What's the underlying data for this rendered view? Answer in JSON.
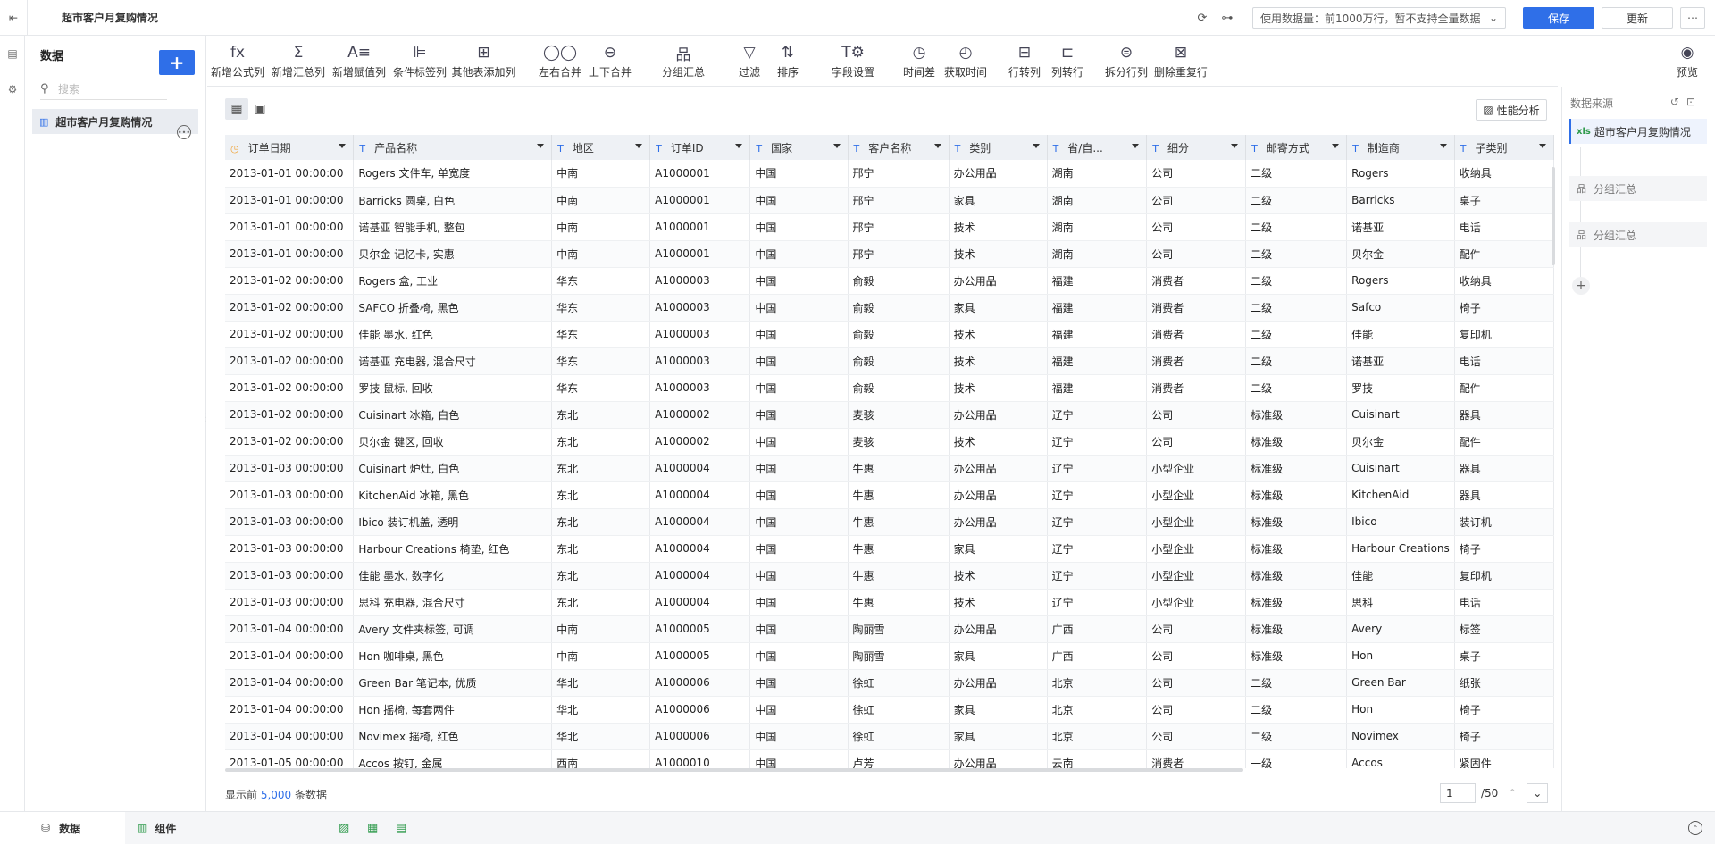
{
  "topbar": {
    "title": "超市客户月复购情况",
    "data_select": "使用数据量：前1000万行，暂不支持全量数据",
    "save": "保存",
    "refresh": "更新"
  },
  "sidebar": {
    "title": "数据",
    "search_placeholder": "搜索",
    "items": [
      {
        "label": "超市客户月复购情况"
      }
    ]
  },
  "toolbar": {
    "tools": [
      {
        "icon": "fx",
        "label": "新增公式列"
      },
      {
        "icon": "Σ",
        "label": "新增汇总列"
      },
      {
        "icon": "A≡",
        "label": "新增赋值列"
      },
      {
        "icon": "⊫",
        "label": "条件标签列"
      },
      {
        "icon": "⊞",
        "label": "其他表添加列"
      },
      {
        "icon": "◯◯",
        "label": "左右合并"
      },
      {
        "icon": "⊖",
        "label": "上下合并"
      },
      {
        "icon": "品",
        "label": "分组汇总"
      },
      {
        "icon": "▽",
        "label": "过滤"
      },
      {
        "icon": "⇅",
        "label": "排序"
      },
      {
        "icon": "T⚙",
        "label": "字段设置"
      },
      {
        "icon": "◷",
        "label": "时间差"
      },
      {
        "icon": "◴",
        "label": "获取时间"
      },
      {
        "icon": "⊟",
        "label": "行转列"
      },
      {
        "icon": "⊏",
        "label": "列转行"
      },
      {
        "icon": "⊜",
        "label": "拆分行列"
      },
      {
        "icon": "⊠",
        "label": "删除重复行"
      }
    ],
    "preview": "预览"
  },
  "content": {
    "perf_button": "性能分析",
    "footer_prefix": "显示前 ",
    "footer_count": "5,000",
    "footer_suffix": " 条数据",
    "page_current": "1",
    "page_total": "/50"
  },
  "table": {
    "columns": [
      "订单日期",
      "产品名称",
      "地区",
      "订单ID",
      "国家",
      "客户名称",
      "类别",
      "省/自...",
      "细分",
      "邮寄方式",
      "制造商",
      "子类别"
    ],
    "rows": [
      [
        "2013-01-01 00:00:00",
        "Rogers 文件车, 单宽度",
        "中南",
        "A1000001",
        "中国",
        "邢宁",
        "办公用品",
        "湖南",
        "公司",
        "二级",
        "Rogers",
        "收纳具"
      ],
      [
        "2013-01-01 00:00:00",
        "Barricks 圆桌, 白色",
        "中南",
        "A1000001",
        "中国",
        "邢宁",
        "家具",
        "湖南",
        "公司",
        "二级",
        "Barricks",
        "桌子"
      ],
      [
        "2013-01-01 00:00:00",
        "诺基亚 智能手机, 整包",
        "中南",
        "A1000001",
        "中国",
        "邢宁",
        "技术",
        "湖南",
        "公司",
        "二级",
        "诺基亚",
        "电话"
      ],
      [
        "2013-01-01 00:00:00",
        "贝尔金 记忆卡, 实惠",
        "中南",
        "A1000001",
        "中国",
        "邢宁",
        "技术",
        "湖南",
        "公司",
        "二级",
        "贝尔金",
        "配件"
      ],
      [
        "2013-01-02 00:00:00",
        "Rogers 盒, 工业",
        "华东",
        "A1000003",
        "中国",
        "俞毅",
        "办公用品",
        "福建",
        "消费者",
        "二级",
        "Rogers",
        "收纳具"
      ],
      [
        "2013-01-02 00:00:00",
        "SAFCO 折叠椅, 黑色",
        "华东",
        "A1000003",
        "中国",
        "俞毅",
        "家具",
        "福建",
        "消费者",
        "二级",
        "Safco",
        "椅子"
      ],
      [
        "2013-01-02 00:00:00",
        "佳能 墨水, 红色",
        "华东",
        "A1000003",
        "中国",
        "俞毅",
        "技术",
        "福建",
        "消费者",
        "二级",
        "佳能",
        "复印机"
      ],
      [
        "2013-01-02 00:00:00",
        "诺基亚 充电器, 混合尺寸",
        "华东",
        "A1000003",
        "中国",
        "俞毅",
        "技术",
        "福建",
        "消费者",
        "二级",
        "诺基亚",
        "电话"
      ],
      [
        "2013-01-02 00:00:00",
        "罗技 鼠标, 回收",
        "华东",
        "A1000003",
        "中国",
        "俞毅",
        "技术",
        "福建",
        "消费者",
        "二级",
        "罗技",
        "配件"
      ],
      [
        "2013-01-02 00:00:00",
        "Cuisinart 冰箱, 白色",
        "东北",
        "A1000002",
        "中国",
        "麦骇",
        "办公用品",
        "辽宁",
        "公司",
        "标准级",
        "Cuisinart",
        "器具"
      ],
      [
        "2013-01-02 00:00:00",
        "贝尔金 键区, 回收",
        "东北",
        "A1000002",
        "中国",
        "麦骇",
        "技术",
        "辽宁",
        "公司",
        "标准级",
        "贝尔金",
        "配件"
      ],
      [
        "2013-01-03 00:00:00",
        "Cuisinart 炉灶, 白色",
        "东北",
        "A1000004",
        "中国",
        "牛惠",
        "办公用品",
        "辽宁",
        "小型企业",
        "标准级",
        "Cuisinart",
        "器具"
      ],
      [
        "2013-01-03 00:00:00",
        "KitchenAid 冰箱, 黑色",
        "东北",
        "A1000004",
        "中国",
        "牛惠",
        "办公用品",
        "辽宁",
        "小型企业",
        "标准级",
        "KitchenAid",
        "器具"
      ],
      [
        "2013-01-03 00:00:00",
        "Ibico 装订机盖, 透明",
        "东北",
        "A1000004",
        "中国",
        "牛惠",
        "办公用品",
        "辽宁",
        "小型企业",
        "标准级",
        "Ibico",
        "装订机"
      ],
      [
        "2013-01-03 00:00:00",
        "Harbour Creations 椅垫, 红色",
        "东北",
        "A1000004",
        "中国",
        "牛惠",
        "家具",
        "辽宁",
        "小型企业",
        "标准级",
        "Harbour Creations",
        "椅子"
      ],
      [
        "2013-01-03 00:00:00",
        "佳能 墨水, 数字化",
        "东北",
        "A1000004",
        "中国",
        "牛惠",
        "技术",
        "辽宁",
        "小型企业",
        "标准级",
        "佳能",
        "复印机"
      ],
      [
        "2013-01-03 00:00:00",
        "思科 充电器, 混合尺寸",
        "东北",
        "A1000004",
        "中国",
        "牛惠",
        "技术",
        "辽宁",
        "小型企业",
        "标准级",
        "思科",
        "电话"
      ],
      [
        "2013-01-04 00:00:00",
        "Avery 文件夹标签, 可调",
        "中南",
        "A1000005",
        "中国",
        "陶丽雪",
        "办公用品",
        "广西",
        "公司",
        "标准级",
        "Avery",
        "标签"
      ],
      [
        "2013-01-04 00:00:00",
        "Hon 咖啡桌, 黑色",
        "中南",
        "A1000005",
        "中国",
        "陶丽雪",
        "家具",
        "广西",
        "公司",
        "标准级",
        "Hon",
        "桌子"
      ],
      [
        "2013-01-04 00:00:00",
        "Green Bar 笔记本, 优质",
        "华北",
        "A1000006",
        "中国",
        "徐虹",
        "办公用品",
        "北京",
        "公司",
        "二级",
        "Green Bar",
        "纸张"
      ],
      [
        "2013-01-04 00:00:00",
        "Hon 摇椅, 每套两件",
        "华北",
        "A1000006",
        "中国",
        "徐虹",
        "家具",
        "北京",
        "公司",
        "二级",
        "Hon",
        "椅子"
      ],
      [
        "2013-01-04 00:00:00",
        "Novimex 摇椅, 红色",
        "华北",
        "A1000006",
        "中国",
        "徐虹",
        "家具",
        "北京",
        "公司",
        "二级",
        "Novimex",
        "椅子"
      ],
      [
        "2013-01-05 00:00:00",
        "Accos 按钉, 金属",
        "西南",
        "A1000010",
        "中国",
        "卢芳",
        "办公用品",
        "云南",
        "消费者",
        "一级",
        "Accos",
        "紧固件"
      ]
    ]
  },
  "rpanel": {
    "title": "数据来源",
    "source": "超市客户月复购情况",
    "steps": [
      "分组汇总",
      "分组汇总"
    ]
  },
  "bottombar": {
    "tab_data": "数据",
    "tab_component": "组件"
  }
}
